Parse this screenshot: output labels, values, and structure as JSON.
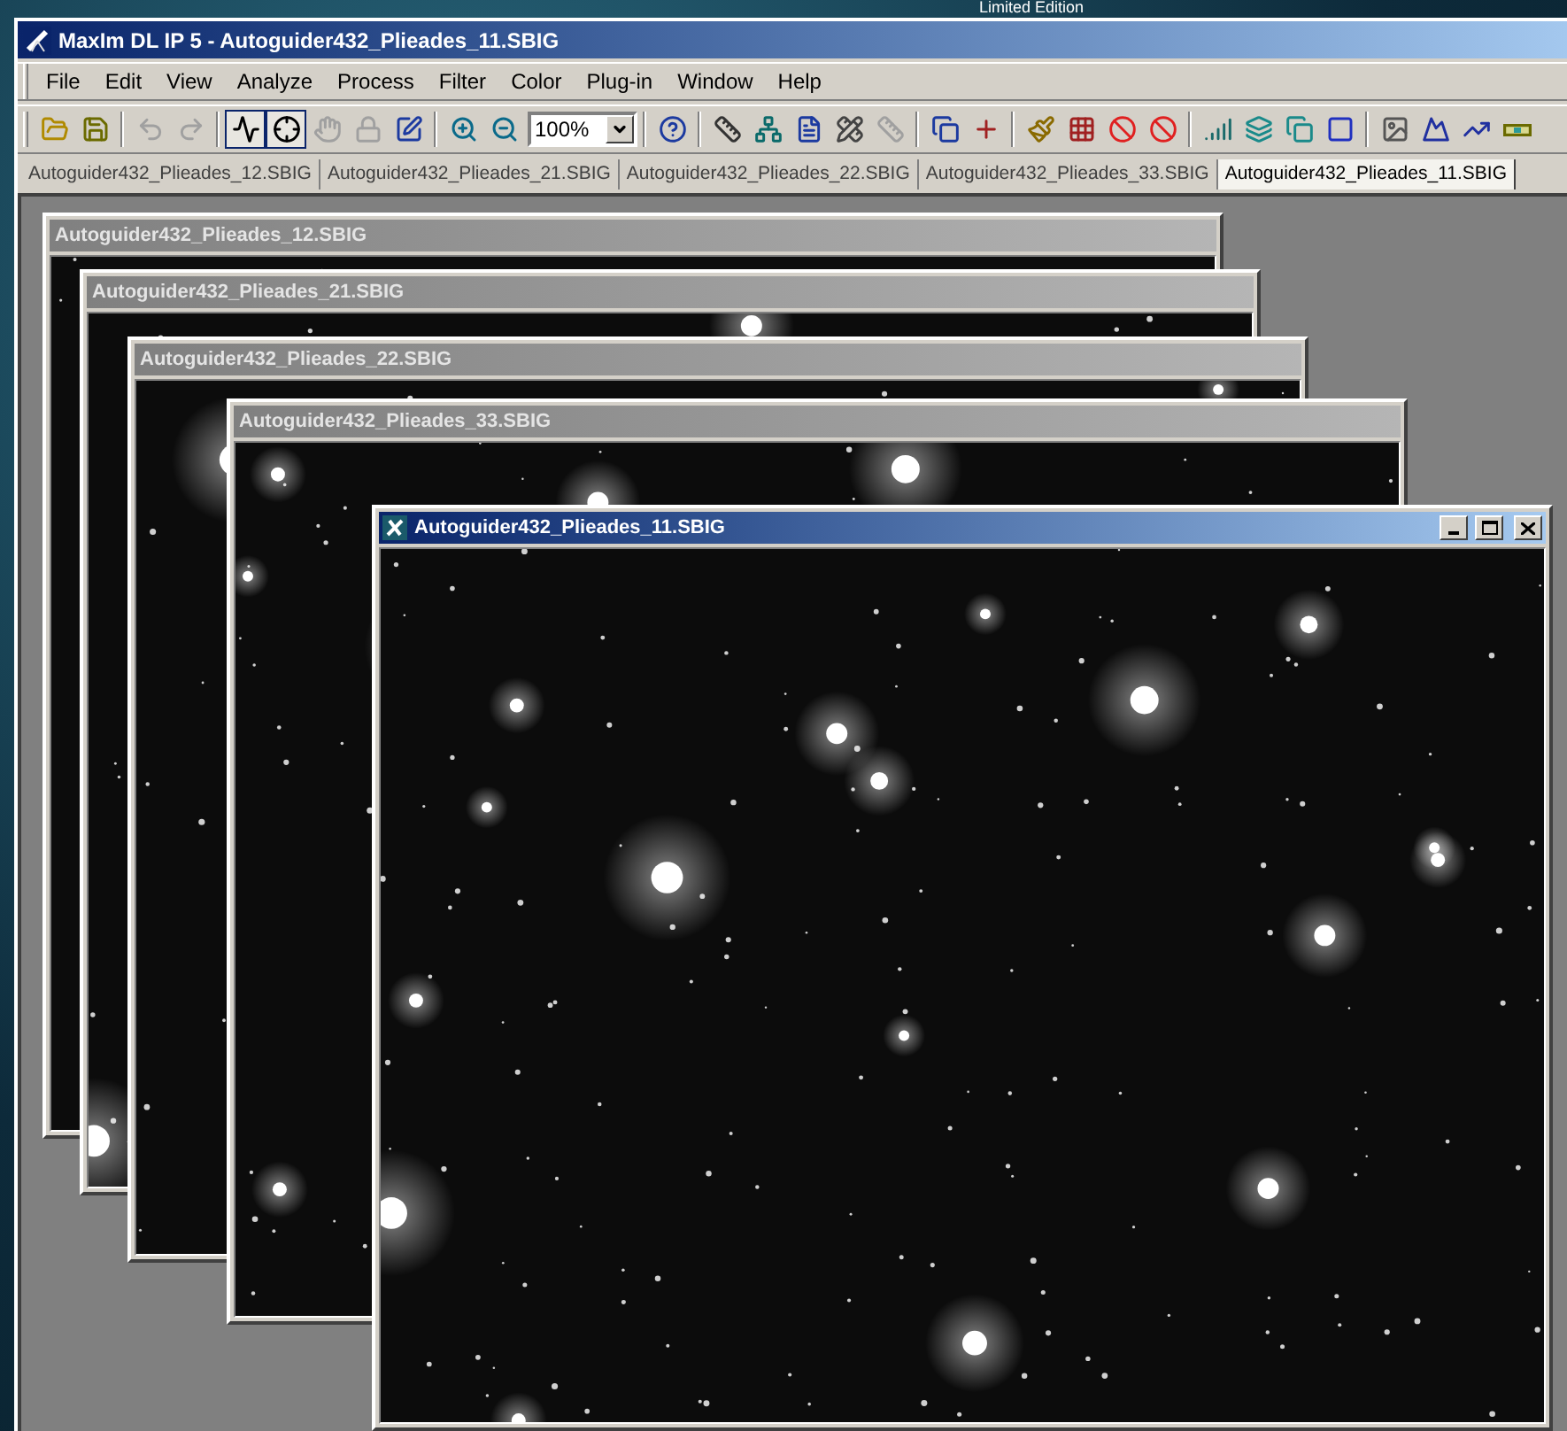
{
  "desktop": {
    "caption": "Limited Edition"
  },
  "window": {
    "title": "MaxIm DL IP 5 - Autoguider432_Plieades_11.SBIG"
  },
  "menu": [
    "File",
    "Edit",
    "View",
    "Analyze",
    "Process",
    "Filter",
    "Color",
    "Plug-in",
    "Window",
    "Help"
  ],
  "toolbar": {
    "groups": [
      {
        "items": [
          {
            "kind": "button",
            "pressed": false,
            "disabled": false
          },
          {
            "kind": "button",
            "pressed": false,
            "disabled": false
          }
        ]
      },
      {
        "items": [
          {
            "kind": "button",
            "pressed": false,
            "disabled": true
          },
          {
            "kind": "button",
            "pressed": false,
            "disabled": true
          }
        ]
      },
      {
        "items": [
          {
            "kind": "button",
            "pressed": true,
            "disabled": false
          },
          {
            "kind": "button",
            "pressed": true,
            "disabled": false
          },
          {
            "kind": "button",
            "pressed": false,
            "disabled": true
          },
          {
            "kind": "button",
            "pressed": false,
            "disabled": true
          },
          {
            "kind": "button",
            "pressed": false,
            "disabled": false
          }
        ]
      },
      {
        "items": [
          {
            "kind": "button",
            "pressed": false,
            "disabled": false
          },
          {
            "kind": "button",
            "pressed": false,
            "disabled": false
          },
          {
            "kind": "combo",
            "value": "100%"
          }
        ]
      },
      {
        "items": [
          {
            "kind": "button",
            "pressed": false,
            "disabled": false
          }
        ]
      },
      {
        "items": [
          {
            "kind": "button",
            "pressed": false,
            "disabled": false
          },
          {
            "kind": "button",
            "pressed": false,
            "disabled": false
          },
          {
            "kind": "button",
            "pressed": false,
            "disabled": false
          },
          {
            "kind": "button",
            "pressed": false,
            "disabled": false
          },
          {
            "kind": "button",
            "pressed": false,
            "disabled": true
          }
        ]
      },
      {
        "items": [
          {
            "kind": "button",
            "pressed": false,
            "disabled": false
          },
          {
            "kind": "button",
            "pressed": false,
            "disabled": false
          }
        ]
      },
      {
        "items": [
          {
            "kind": "button",
            "pressed": false,
            "disabled": false
          },
          {
            "kind": "button",
            "pressed": false,
            "disabled": false
          },
          {
            "kind": "button",
            "pressed": false,
            "disabled": false
          },
          {
            "kind": "button",
            "pressed": false,
            "disabled": false
          }
        ]
      },
      {
        "items": [
          {
            "kind": "button",
            "pressed": false,
            "disabled": false
          },
          {
            "kind": "button",
            "pressed": false,
            "disabled": false
          },
          {
            "kind": "button",
            "pressed": false,
            "disabled": false
          },
          {
            "kind": "button",
            "pressed": false,
            "disabled": false
          }
        ]
      },
      {
        "items": [
          {
            "kind": "button",
            "pressed": false,
            "disabled": false
          },
          {
            "kind": "button",
            "pressed": false,
            "disabled": false
          },
          {
            "kind": "button",
            "pressed": false,
            "disabled": false
          },
          {
            "kind": "button",
            "pressed": false,
            "disabled": false
          }
        ]
      }
    ]
  },
  "tabs": [
    {
      "label": "Autoguider432_Plieades_12.SBIG",
      "selected": false
    },
    {
      "label": "Autoguider432_Plieades_21.SBIG",
      "selected": false
    },
    {
      "label": "Autoguider432_Plieades_22.SBIG",
      "selected": false
    },
    {
      "label": "Autoguider432_Plieades_33.SBIG",
      "selected": false
    },
    {
      "label": "Autoguider432_Plieades_11.SBIG",
      "selected": true
    }
  ],
  "documents": [
    {
      "title": "Autoguider432_Plieades_12.SBIG",
      "active": false
    },
    {
      "title": "Autoguider432_Plieades_21.SBIG",
      "active": false
    },
    {
      "title": "Autoguider432_Plieades_22.SBIG",
      "active": false
    },
    {
      "title": "Autoguider432_Plieades_33.SBIG",
      "active": false
    },
    {
      "title": "Autoguider432_Plieades_11.SBIG",
      "active": true
    }
  ]
}
